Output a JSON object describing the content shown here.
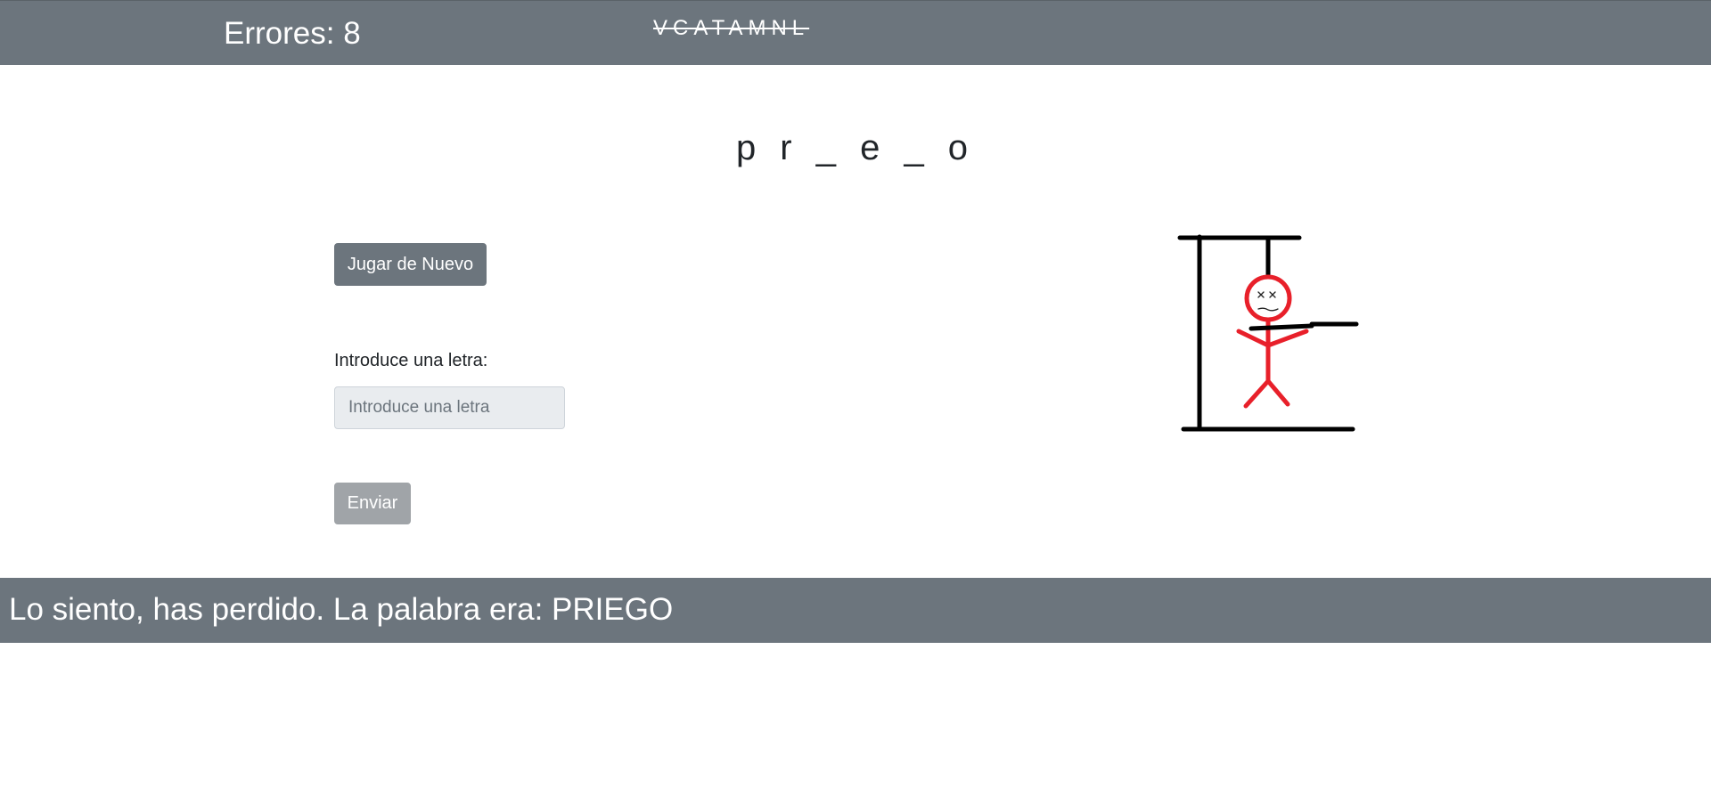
{
  "header": {
    "errors_text": "Errores: 8",
    "used_letters": "VCATAMNL"
  },
  "game": {
    "word_display": "p r _ e _ o",
    "play_again_label": "Jugar de Nuevo",
    "input_label": "Introduce una letra:",
    "input_placeholder": "Introduce una letra",
    "input_value": "",
    "submit_label": "Enviar",
    "submit_disabled": true,
    "input_disabled": true
  },
  "hangman": {
    "errors": 8,
    "gallows_color": "#000000",
    "figure_color": "#e8202a",
    "icon": "hangman-drawing"
  },
  "result": {
    "message": "Lo siento, has perdido. La palabra era: PRIEGO"
  },
  "colors": {
    "bar_background": "#6c757d",
    "button_secondary": "#6c757d",
    "button_disabled": "#a0a4a8",
    "input_disabled_bg": "#e9ecef"
  }
}
